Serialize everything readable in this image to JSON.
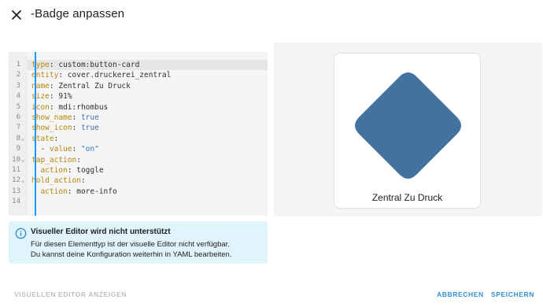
{
  "dialog": {
    "title": "-Badge anpassen",
    "close_icon": "close-icon"
  },
  "editor": {
    "lines": [
      {
        "n": "1",
        "fold": false,
        "key": "type",
        "sep": ": ",
        "value": "custom:button-card",
        "vtype": "plain"
      },
      {
        "n": "2",
        "fold": false,
        "key": "entity",
        "sep": ": ",
        "value": "cover.druckerei_zentral",
        "vtype": "plain"
      },
      {
        "n": "3",
        "fold": false,
        "key": "name",
        "sep": ": ",
        "value": "Zentral Zu Druck",
        "vtype": "plain"
      },
      {
        "n": "4",
        "fold": false,
        "key": "size",
        "sep": ": ",
        "value": "91%",
        "vtype": "plain"
      },
      {
        "n": "5",
        "fold": false,
        "key": "icon",
        "sep": ": ",
        "value": "mdi:rhombus",
        "vtype": "plain"
      },
      {
        "n": "6",
        "fold": false,
        "key": "show_name",
        "sep": ": ",
        "value": "true",
        "vtype": "bool"
      },
      {
        "n": "7",
        "fold": false,
        "key": "show_icon",
        "sep": ": ",
        "value": "true",
        "vtype": "bool"
      },
      {
        "n": "8",
        "fold": true,
        "key": "state",
        "sep": ":",
        "value": "",
        "vtype": "plain"
      },
      {
        "n": "9",
        "fold": false,
        "indent": "  - ",
        "key": "value",
        "sep": ": ",
        "value": "\"on\"",
        "vtype": "string"
      },
      {
        "n": "10",
        "fold": true,
        "key": "tap_action",
        "sep": ":",
        "value": "",
        "vtype": "plain"
      },
      {
        "n": "11",
        "fold": false,
        "indent": "  ",
        "key": "action",
        "sep": ": ",
        "value": "toggle",
        "vtype": "plain"
      },
      {
        "n": "12",
        "fold": true,
        "key": "hold_action",
        "sep": ":",
        "value": "",
        "vtype": "plain"
      },
      {
        "n": "13",
        "fold": false,
        "indent": "  ",
        "key": "action",
        "sep": ": ",
        "value": "more-info",
        "vtype": "plain"
      },
      {
        "n": "14",
        "fold": false,
        "key": "",
        "sep": "",
        "value": "",
        "vtype": "plain"
      }
    ]
  },
  "preview": {
    "icon": "rhombus-icon",
    "name": "Zentral Zu Druck",
    "icon_color": "#43729e"
  },
  "info": {
    "icon": "info-icon",
    "title": "Visueller Editor wird nicht unterstützt",
    "line1": "Für diesen Elementtyp ist der visuelle Editor nicht verfügbar.",
    "line2": "Du kannst deine Konfiguration weiterhin in YAML bearbeiten."
  },
  "footer": {
    "show_visual_label": "Visuellen Editor anzeigen",
    "cancel_label": "Abbrechen",
    "save_label": "Speichern"
  },
  "colors": {
    "accent": "#2196f3",
    "info_bg": "#e1f3fb",
    "info_icon": "#2f8fd8"
  }
}
